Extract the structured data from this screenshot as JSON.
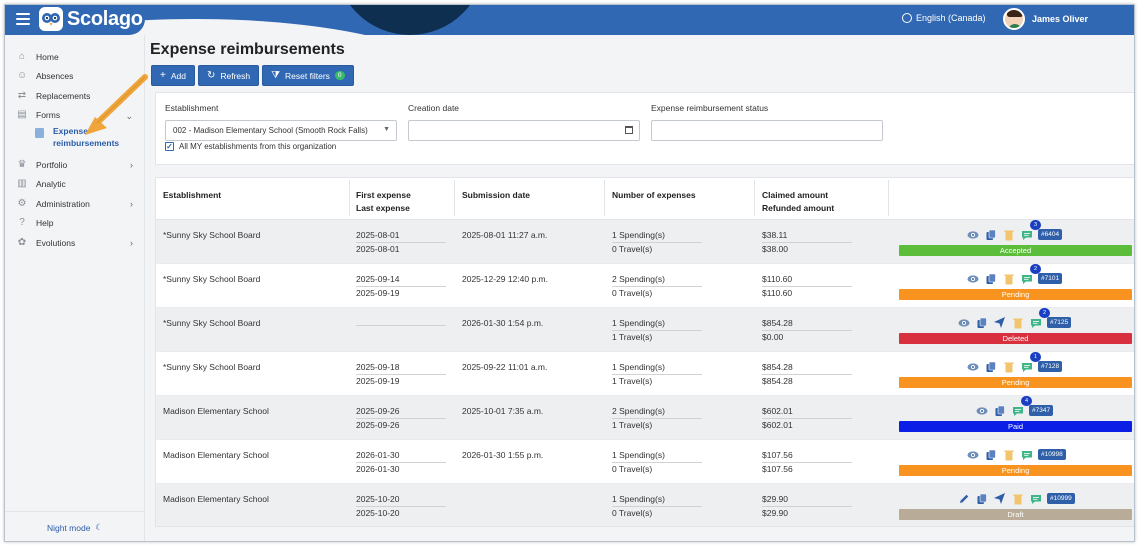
{
  "app": {
    "brand": "Scolago",
    "language": "English (Canada)",
    "user_name": "James Oliver"
  },
  "sidebar": {
    "items": [
      {
        "label": "Home",
        "icon": "home-icon"
      },
      {
        "label": "Absences",
        "icon": "person-icon"
      },
      {
        "label": "Replacements",
        "icon": "swap-icon"
      },
      {
        "label": "Forms",
        "icon": "document-icon",
        "expanded": true
      },
      {
        "label": "Portfolio",
        "icon": "trophy-icon",
        "has_children": true
      },
      {
        "label": "Analytic",
        "icon": "chart-icon"
      },
      {
        "label": "Administration",
        "icon": "gear-icon",
        "has_children": true
      },
      {
        "label": "Help",
        "icon": "question-icon"
      },
      {
        "label": "Evolutions",
        "icon": "sprout-icon",
        "has_children": true
      }
    ],
    "sub_item": {
      "label": "Expense reimbursements",
      "line1": "Expense",
      "line2": "reimbursements"
    },
    "night_mode": "Night mode"
  },
  "page": {
    "title": "Expense reimbursements",
    "toolbar": {
      "add_label": "Add",
      "refresh_label": "Refresh",
      "reset_label": "Reset filters",
      "reset_count": "0"
    }
  },
  "filters": {
    "establishment_label": "Establishment",
    "establishment_value": "002 - Madison Elementary School (Smooth Rock Falls)",
    "creation_date_label": "Creation date",
    "creation_date_value": "",
    "status_label": "Expense reimbursement status",
    "status_value": "",
    "all_establishments_label": "All MY establishments from this organization",
    "all_establishments_checked": true
  },
  "table": {
    "headers": {
      "establishment": "Establishment",
      "first_expense": "First expense",
      "last_expense": "Last expense",
      "submission_date": "Submission date",
      "number_of_expenses": "Number of expenses",
      "claimed_amount": "Claimed amount",
      "refunded_amount": "Refunded amount"
    },
    "rows": [
      {
        "establishment": "*Sunny Sky School Board",
        "first": "2025-08-01",
        "last": "2025-08-01",
        "submission": "2025-08-01 11:27 a.m.",
        "spending": "1 Spending(s)",
        "travel": "0 Travel(s)",
        "claimed": "$38.11",
        "refunded": "$38.00",
        "ref": "#6404",
        "comments": "3",
        "status": "Accepted",
        "status_color": "#5bbd3a",
        "icons": [
          "view",
          "copy",
          "delete",
          "comment"
        ]
      },
      {
        "establishment": "*Sunny Sky School Board",
        "first": "2025-09-14",
        "last": "2025-09-19",
        "submission": "2025-12-29 12:40 p.m.",
        "spending": "2 Spending(s)",
        "travel": "0 Travel(s)",
        "claimed": "$110.60",
        "refunded": "$110.60",
        "ref": "#7101",
        "comments": "2",
        "status": "Pending",
        "status_color": "#f7931e",
        "icons": [
          "view",
          "copy",
          "delete",
          "comment"
        ]
      },
      {
        "establishment": "*Sunny Sky School Board",
        "first": "",
        "last": "",
        "submission": "2026-01-30 1:54 p.m.",
        "spending": "1 Spending(s)",
        "travel": "1 Travel(s)",
        "claimed": "$854.28",
        "refunded": "$0.00",
        "ref": "#7125",
        "comments": "2",
        "status": "Deleted",
        "status_color": "#d9303f",
        "icons": [
          "view",
          "copy",
          "send",
          "delete",
          "comment"
        ]
      },
      {
        "establishment": "*Sunny Sky School Board",
        "first": "2025-09-18",
        "last": "2025-09-19",
        "submission": "2025-09-22 11:01 a.m.",
        "spending": "1 Spending(s)",
        "travel": "1 Travel(s)",
        "claimed": "$854.28",
        "refunded": "$854.28",
        "ref": "#7128",
        "comments": "1",
        "status": "Pending",
        "status_color": "#f7931e",
        "icons": [
          "view",
          "copy",
          "delete",
          "comment"
        ]
      },
      {
        "establishment": "Madison Elementary School",
        "first": "2025-09-26",
        "last": "2025-09-26",
        "submission": "2025-10-01 7:35 a.m.",
        "spending": "2 Spending(s)",
        "travel": "1 Travel(s)",
        "claimed": "$602.01",
        "refunded": "$602.01",
        "ref": "#7347",
        "comments": "4",
        "status": "Paid",
        "status_color": "#0a1ee6",
        "icons": [
          "view",
          "copy",
          "comment"
        ]
      },
      {
        "establishment": "Madison Elementary School",
        "first": "2026-01-30",
        "last": "2026-01-30",
        "submission": "2026-01-30 1:55 p.m.",
        "spending": "1 Spending(s)",
        "travel": "0 Travel(s)",
        "claimed": "$107.56",
        "refunded": "$107.56",
        "ref": "#10998",
        "comments": "",
        "status": "Pending",
        "status_color": "#f7931e",
        "icons": [
          "view",
          "copy",
          "delete",
          "comment"
        ]
      },
      {
        "establishment": "Madison Elementary School",
        "first": "2025-10-20",
        "last": "2025-10-20",
        "submission": "",
        "spending": "1 Spending(s)",
        "travel": "0 Travel(s)",
        "claimed": "$29.90",
        "refunded": "$29.90",
        "ref": "#10999",
        "comments": "",
        "status": "Draft",
        "status_color": "#b8ab97",
        "icons": [
          "edit",
          "copy",
          "send",
          "delete",
          "comment"
        ]
      }
    ]
  },
  "colors": {
    "brand": "#3168b3",
    "arrow": "#f0a53b",
    "icon_blue": "#2f5fa8",
    "icon_trash": "#f2c46b",
    "icon_comment": "#3fb58a"
  }
}
